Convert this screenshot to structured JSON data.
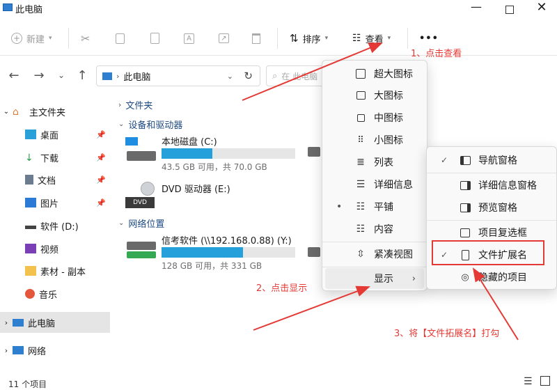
{
  "window": {
    "title": "此电脑"
  },
  "toolbar": {
    "new_label": "新建",
    "sort_label": "排序",
    "view_label": "查看",
    "more_label": "•••"
  },
  "address": {
    "path": "此电脑",
    "search_placeholder": "在 此电脑"
  },
  "sidebar": {
    "items": [
      {
        "label": "主文件夹"
      },
      {
        "label": "桌面"
      },
      {
        "label": "下载"
      },
      {
        "label": "文档"
      },
      {
        "label": "图片"
      },
      {
        "label": "软件 (D:)"
      },
      {
        "label": "视频"
      },
      {
        "label": "素材 - 副本"
      },
      {
        "label": "音乐"
      },
      {
        "label": "此电脑"
      },
      {
        "label": "网络"
      }
    ]
  },
  "content": {
    "sections": {
      "folders": "文件夹",
      "devices": "设备和驱动器",
      "network": "网络位置"
    },
    "drives": [
      {
        "name": "本地磁盘 (C:)",
        "detail": "43.5 GB 可用，共 70.0 GB",
        "used_fraction": 0.38
      },
      {
        "name": "DVD 驱动器 (E:)",
        "detail": "",
        "used_fraction": null
      },
      {
        "name": "信考软件 (\\\\192.168.0.88) (Y:)",
        "detail": "128 GB 可用，共 331 GB",
        "used_fraction": 0.61
      }
    ],
    "dvd_label": "DVD"
  },
  "view_menu": {
    "items": [
      {
        "label": "超大图标"
      },
      {
        "label": "大图标"
      },
      {
        "label": "中图标"
      },
      {
        "label": "小图标"
      },
      {
        "label": "列表"
      },
      {
        "label": "详细信息"
      },
      {
        "label": "平铺"
      },
      {
        "label": "内容"
      },
      {
        "label": "紧凑视图"
      },
      {
        "label": "显示"
      }
    ]
  },
  "show_menu": {
    "items": [
      {
        "label": "导航窗格"
      },
      {
        "label": "详细信息窗格"
      },
      {
        "label": "预览窗格"
      },
      {
        "label": "项目复选框"
      },
      {
        "label": "文件扩展名"
      },
      {
        "label": "隐藏的项目"
      }
    ]
  },
  "annotations": {
    "step1": "1、点击查看",
    "step2": "2、点击显示",
    "step3": "3、将【文件拓展名】打勾"
  },
  "status": {
    "count": "11 个项目"
  },
  "colors": {
    "accent": "#26a0da",
    "annotation": "#e53935",
    "link": "#1d4b82"
  }
}
